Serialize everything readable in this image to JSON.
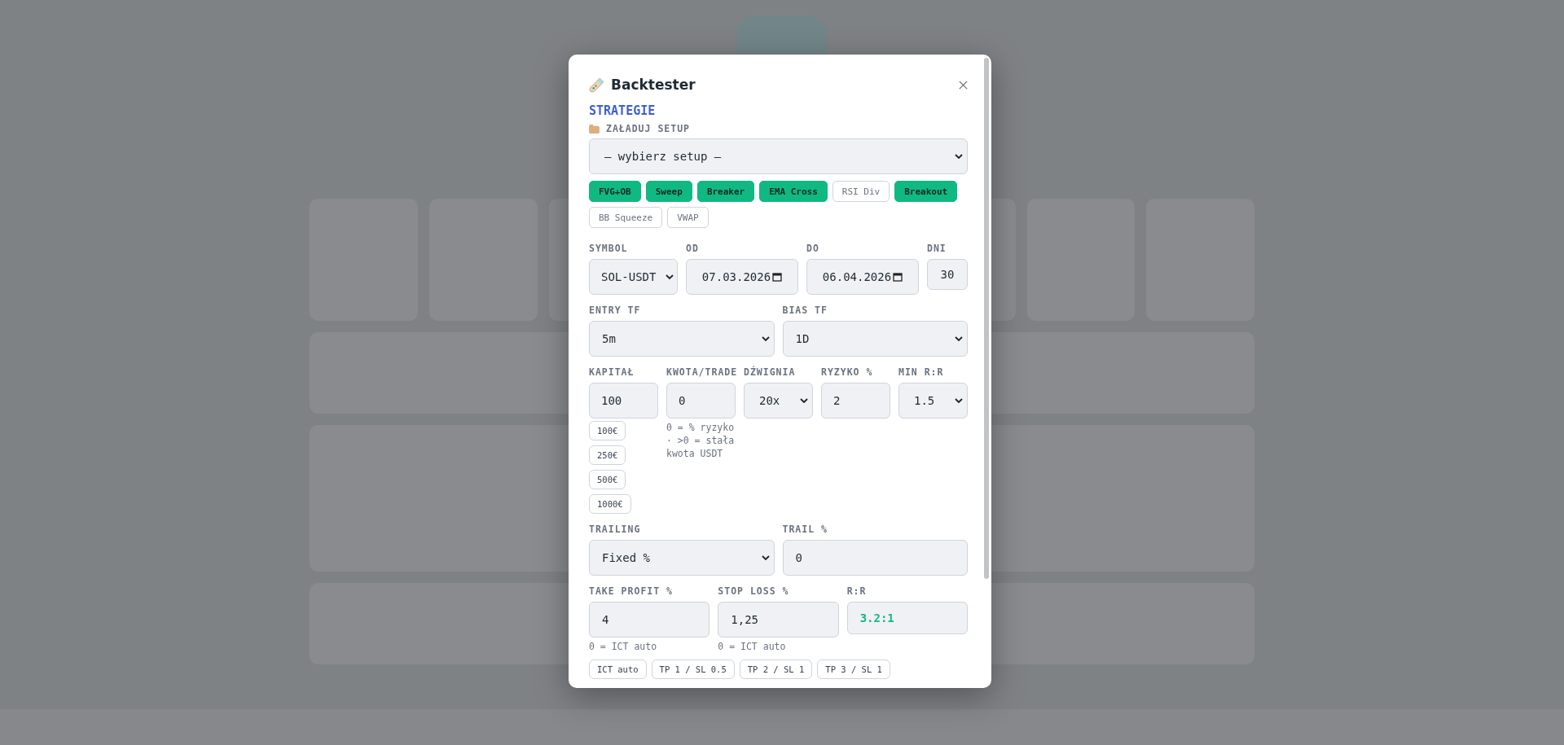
{
  "modal": {
    "title": "Backtester",
    "section_title": "STRATEGIE",
    "setup": {
      "label": "ZAŁADUJ SETUP",
      "value": "— wybierz setup —"
    },
    "strategies": [
      {
        "label": "FVG+OB",
        "selected": true
      },
      {
        "label": "Sweep",
        "selected": true
      },
      {
        "label": "Breaker",
        "selected": true
      },
      {
        "label": "EMA Cross",
        "selected": true
      },
      {
        "label": "RSI Div",
        "selected": false
      },
      {
        "label": "Breakout",
        "selected": true
      },
      {
        "label": "BB Squeeze",
        "selected": false
      },
      {
        "label": "VWAP",
        "selected": false
      }
    ],
    "rows": [
      {
        "fields": [
          {
            "kind": "select",
            "label": "SYMBOL",
            "value": "SOL-USDT"
          },
          {
            "kind": "date",
            "label": "OD",
            "value": "07.03.2026"
          },
          {
            "kind": "date",
            "label": "DO",
            "value": "06.04.2026"
          },
          {
            "kind": "input",
            "label": "DNI",
            "value": "30"
          }
        ]
      },
      {
        "fields": [
          {
            "kind": "select",
            "label": "ENTRY TF",
            "value": "5m"
          },
          {
            "kind": "select",
            "label": "BIAS TF",
            "value": "1D"
          }
        ]
      },
      {
        "fields": [
          {
            "kind": "input",
            "label": "KAPITAŁ",
            "value": "100",
            "presets": [
              "100€",
              "250€",
              "500€",
              "1000€"
            ]
          },
          {
            "kind": "input",
            "label": "KWOTA/TRADE",
            "value": "0",
            "hint": "0 = % ryzyko · >0 = stała kwota USDT"
          },
          {
            "kind": "select",
            "label": "DŹWIGNIA",
            "value": "20x"
          },
          {
            "kind": "input",
            "label": "RYZYKO %",
            "value": "2"
          },
          {
            "kind": "select",
            "label": "MIN R:R",
            "value": "1.5"
          }
        ]
      },
      {
        "fields": [
          {
            "kind": "select",
            "label": "TRAILING",
            "value": "Fixed %"
          },
          {
            "kind": "input",
            "label": "TRAIL %",
            "value": "0"
          }
        ]
      },
      {
        "fields": [
          {
            "kind": "input",
            "label": "TAKE PROFIT %",
            "value": "4",
            "hint": "0 = ICT auto"
          },
          {
            "kind": "input",
            "label": "STOP LOSS %",
            "value": "1,25",
            "hint": "0 = ICT auto"
          },
          {
            "kind": "readout",
            "label": "R:R",
            "value": "3.2:1"
          }
        ]
      }
    ],
    "rr_presets": [
      "ICT auto",
      "TP 1 / SL 0.5",
      "TP 2 / SL 1",
      "TP 3 / SL 1"
    ]
  }
}
